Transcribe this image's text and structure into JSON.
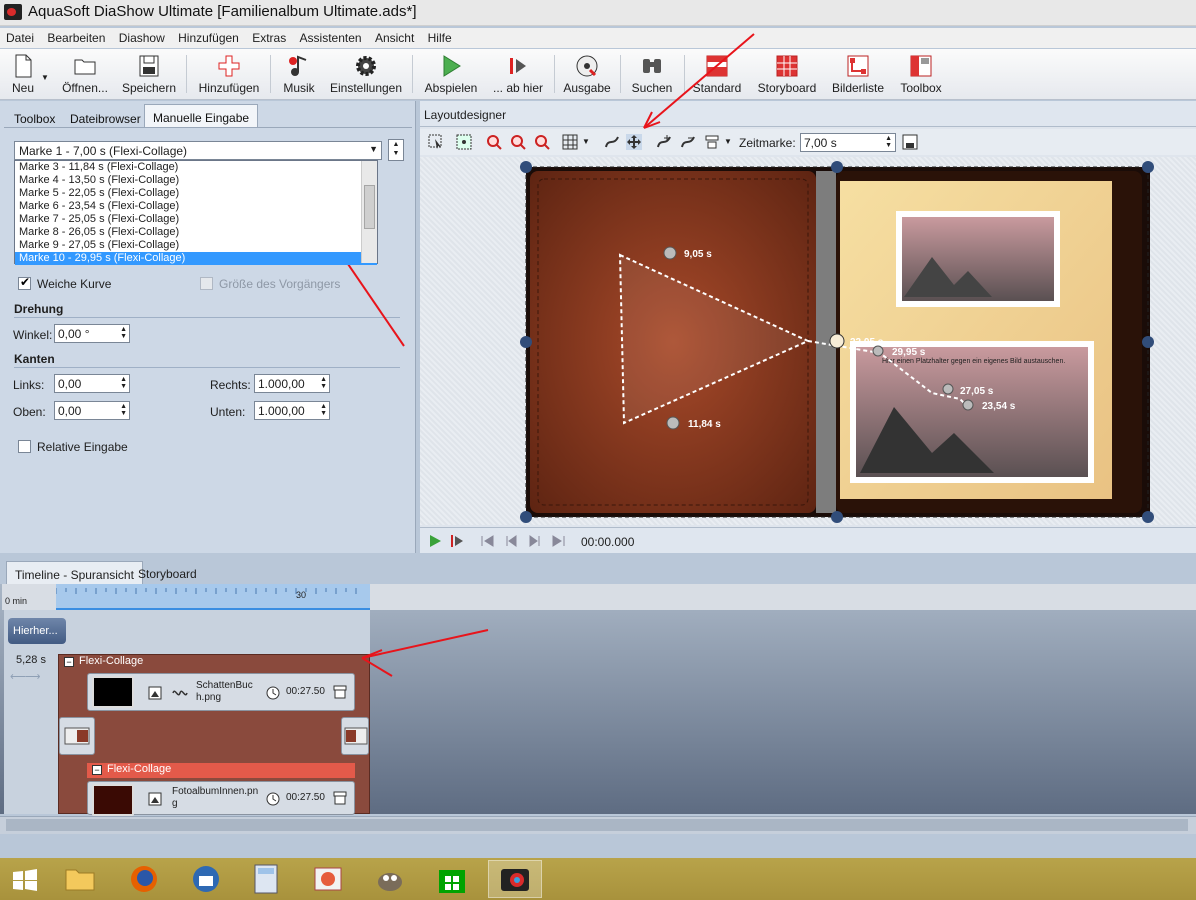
{
  "window": {
    "title": "AquaSoft DiaShow Ultimate [Familienalbum Ultimate.ads*]"
  },
  "menu": [
    "Datei",
    "Bearbeiten",
    "Diashow",
    "Hinzufügen",
    "Extras",
    "Assistenten",
    "Ansicht",
    "Hilfe"
  ],
  "toolbar": {
    "neu": "Neu",
    "oeffnen": "Öffnen...",
    "speichern": "Speichern",
    "hinzufuegen": "Hinzufügen",
    "musik": "Musik",
    "einstellungen": "Einstellungen",
    "abspielen": "Abspielen",
    "ab_hier": "... ab hier",
    "ausgabe": "Ausgabe",
    "suchen": "Suchen",
    "standard": "Standard",
    "storyboard": "Storyboard",
    "bilderliste": "Bilderliste",
    "toolbox": "Toolbox"
  },
  "left_tabs": [
    "Toolbox",
    "Dateibrowser",
    "Manuelle Eingabe"
  ],
  "marker_combo": {
    "value": "Marke 1 - 7,00 s (Flexi-Collage)"
  },
  "marker_list": [
    "Marke 3 - 11,84 s (Flexi-Collage)",
    "Marke 4 - 13,50 s (Flexi-Collage)",
    "Marke 5 - 22,05 s (Flexi-Collage)",
    "Marke 6 - 23,54 s (Flexi-Collage)",
    "Marke 7 - 25,05 s (Flexi-Collage)",
    "Marke 8 - 26,05 s (Flexi-Collage)",
    "Marke 9 - 27,05 s (Flexi-Collage)",
    "Marke 10 - 29,95 s (Flexi-Collage)"
  ],
  "options": {
    "weiche_kurve": "Weiche Kurve",
    "groesse_vorgaenger": "Größe des Vorgängers",
    "relative": "Relative Eingabe"
  },
  "drehung": {
    "title": "Drehung",
    "winkel_label": "Winkel:",
    "winkel_value": "0,00 °"
  },
  "kanten": {
    "title": "Kanten",
    "links_label": "Links:",
    "links_value": "0,00",
    "rechts_label": "Rechts:",
    "rechts_value": "1.000,00",
    "oben_label": "Oben:",
    "oben_value": "0,00",
    "unten_label": "Unten:",
    "unten_value": "1.000,00"
  },
  "designer": {
    "title": "Layoutdesigner",
    "zeitmarke_label": "Zeitmarke:",
    "zeitmarke_value": "7,00 s",
    "time": "00:00.000",
    "markers": [
      "9,05 s",
      "11,84 s",
      "22,05 s",
      "29,95 s",
      "27,05 s",
      "23,54 s"
    ],
    "photo_text_1": "Hier einen Platzhalter gegen ein eigenes Bild austauschen."
  },
  "timeline": {
    "tabs": [
      "Timeline - Spuransicht",
      "Storyboard"
    ],
    "ruler_unit": "0 min",
    "ruler_mark": "30",
    "hierarchy_btn": "Hierher...",
    "duration": "5,28 s",
    "flexi1": "Flexi-Collage",
    "clip1_name": "SchattenBuch.png",
    "clip1_time": "00:27.50",
    "flexi2": "Flexi-Collage",
    "clip2_name": "FotoalbumInnen.png",
    "clip2_time": "00:27.50"
  },
  "taskbar": [
    "windows-start",
    "file-explorer",
    "firefox",
    "thunderbird",
    "calculator",
    "snipping",
    "gimp",
    "store",
    "aquasoft"
  ]
}
